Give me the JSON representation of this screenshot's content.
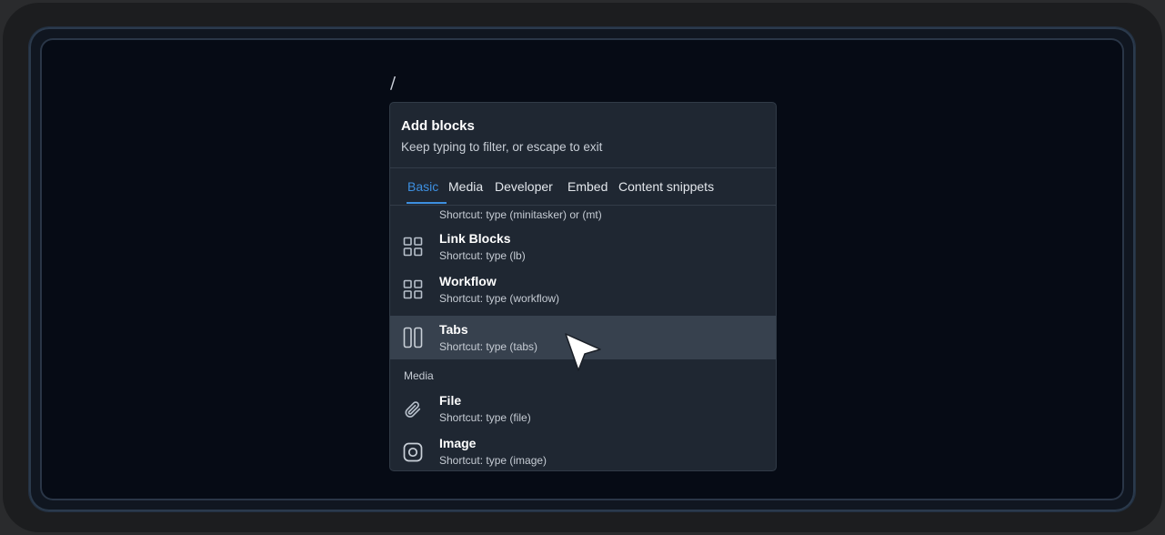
{
  "editor": {
    "caret_text": "/"
  },
  "popup": {
    "title": "Add blocks",
    "subtitle": "Keep typing to filter, or escape to exit",
    "tabs": [
      {
        "label": "Basic",
        "active": true
      },
      {
        "label": "Media",
        "active": false
      },
      {
        "label": "Developer",
        "active": false
      },
      {
        "label": "Embed",
        "active": false
      },
      {
        "label": "Content snippets",
        "active": false
      }
    ],
    "items": [
      {
        "title": "",
        "shortcut": "Shortcut: type (minitasker) or (mt)",
        "icon": "columns-icon",
        "partially_hidden": true
      },
      {
        "title": "Link Blocks",
        "shortcut": "Shortcut: type (lb)",
        "icon": "grid-icon"
      },
      {
        "title": "Workflow",
        "shortcut": "Shortcut: type (workflow)",
        "icon": "grid-icon"
      },
      {
        "title": "Tabs",
        "shortcut": "Shortcut: type (tabs)",
        "icon": "tabs-icon",
        "highlighted": true
      },
      {
        "title": "File",
        "shortcut": "Shortcut: type (file)",
        "icon": "paperclip-icon"
      },
      {
        "title": "Image",
        "shortcut": "Shortcut: type (image)",
        "icon": "instagram-icon"
      }
    ],
    "section_media": "Media"
  },
  "colors": {
    "accent": "#3d8fe0",
    "popup_bg": "#1f2732",
    "highlight_bg": "#37414e",
    "canvas_bg": "#060b15"
  }
}
